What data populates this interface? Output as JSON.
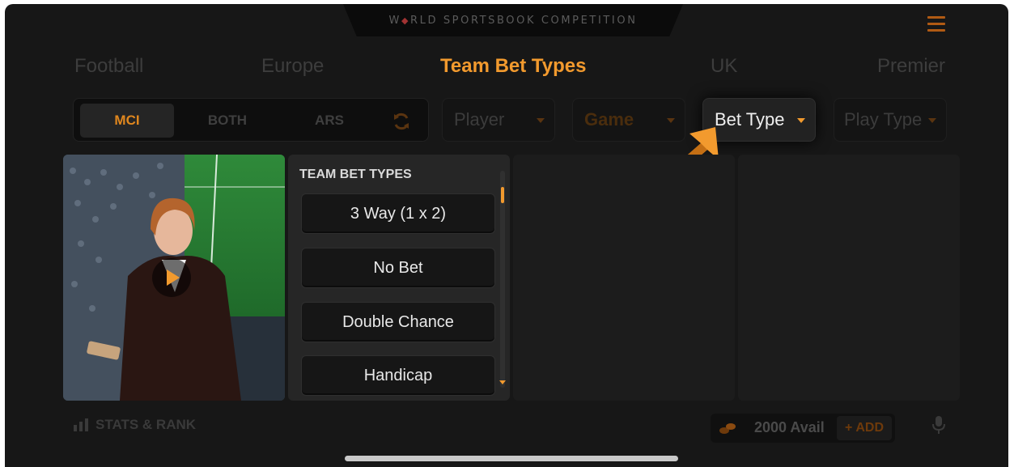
{
  "app": {
    "title_before": "W",
    "title_after": "RLD SPORTSBOOK COMPETITION"
  },
  "nav_tabs": [
    {
      "label": "Football",
      "active": false
    },
    {
      "label": "Europe",
      "active": false
    },
    {
      "label": "Team Bet Types",
      "active": true
    },
    {
      "label": "UK",
      "active": false
    },
    {
      "label": "Premier",
      "active": false
    }
  ],
  "team_toggle": {
    "options": [
      "MCI",
      "BOTH",
      "ARS"
    ],
    "selected": "MCI"
  },
  "dropdowns": {
    "player": "Player",
    "game": "Game",
    "bet_type": "Bet Type",
    "play_type": "Play Type"
  },
  "bet_list": {
    "heading": "TEAM BET TYPES",
    "options": [
      "3 Way (1 x 2)",
      "No Bet",
      "Double Chance",
      "Handicap"
    ]
  },
  "footer": {
    "stats_label": "STATS & RANK",
    "coins_available": "2000 Avail",
    "add_label": "ADD",
    "add_symbol": "+"
  },
  "colors": {
    "accent": "#f29a2e",
    "background": "#171717",
    "panel": "#262626"
  },
  "icons": [
    "menu-icon",
    "refresh-icon",
    "caret-down-icon",
    "pointer-arrow-icon",
    "play-icon",
    "stats-chart-icon",
    "coins-icon",
    "microphone-icon"
  ]
}
